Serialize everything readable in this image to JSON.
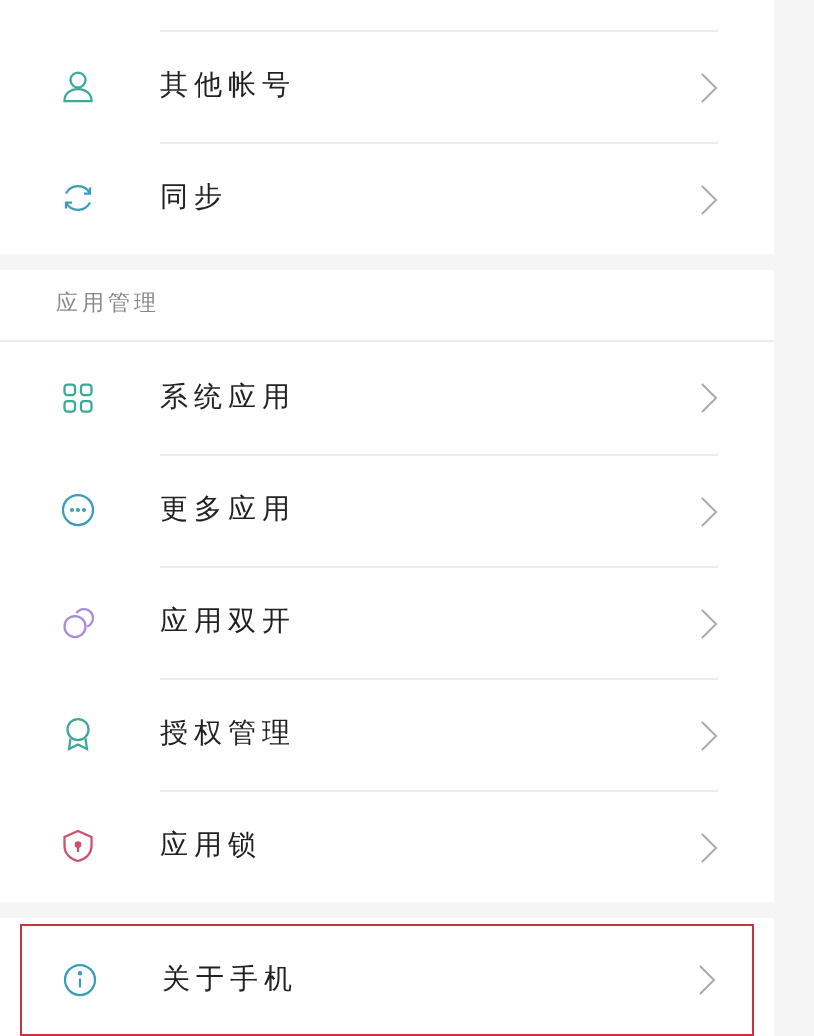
{
  "sections": [
    {
      "items": [
        {
          "label": "其他帐号",
          "kind": "person",
          "highlighted": false
        },
        {
          "label": "同步",
          "kind": "sync",
          "highlighted": false
        }
      ]
    },
    {
      "header": "应用管理",
      "items": [
        {
          "label": "系统应用",
          "kind": "grid",
          "highlighted": false
        },
        {
          "label": "更多应用",
          "kind": "more",
          "highlighted": false
        },
        {
          "label": "应用双开",
          "kind": "dual",
          "highlighted": false
        },
        {
          "label": "授权管理",
          "kind": "award",
          "highlighted": false
        },
        {
          "label": "应用锁",
          "kind": "shield",
          "highlighted": false
        }
      ]
    },
    {
      "items": [
        {
          "label": "关于手机",
          "kind": "info",
          "highlighted": true
        }
      ]
    }
  ]
}
